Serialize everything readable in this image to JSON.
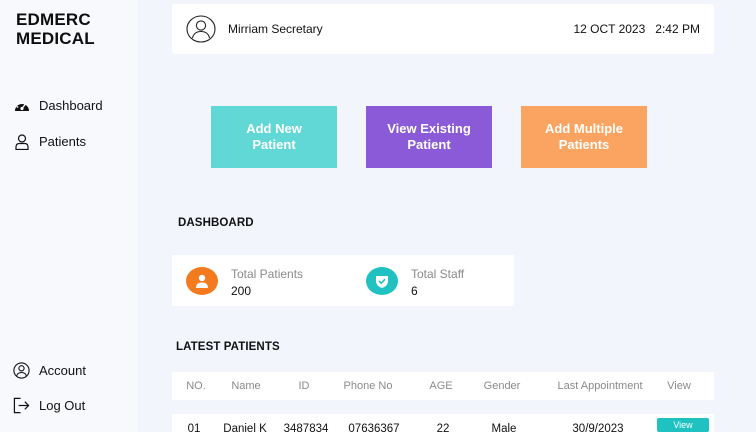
{
  "brand": {
    "line1": "EDMERC",
    "line2": "MEDICAL"
  },
  "sidebar": {
    "items": [
      {
        "label": "Dashboard",
        "icon": "dashboard-gauge-icon"
      },
      {
        "label": "Patients",
        "icon": "person-icon"
      }
    ],
    "bottom": [
      {
        "label": "Account",
        "icon": "account-circle-icon"
      },
      {
        "label": "Log Out",
        "icon": "logout-icon"
      }
    ]
  },
  "header": {
    "user_name": "Mirriam Secretary",
    "date": "12 OCT 2023",
    "time": "2:42 PM"
  },
  "actions": {
    "add_new": "Add New Patient",
    "view_existing": "View Existing Patient",
    "add_multiple": "Add Multiple Patients"
  },
  "dashboard": {
    "title": "DASHBOARD",
    "stats": [
      {
        "label": "Total Patients",
        "value": "200",
        "icon": "patient-icon",
        "color": "#f47a20"
      },
      {
        "label": "Total Staff",
        "value": "6",
        "icon": "shield-check-icon",
        "color": "#1fc2c0"
      }
    ]
  },
  "latest": {
    "title": "LATEST PATIENTS",
    "columns": [
      "NO.",
      "Name",
      "ID",
      "Phone No",
      "AGE",
      "Gender",
      "Last Appointment",
      "View"
    ],
    "rows": [
      {
        "no": "01",
        "name": "Daniel K",
        "id": "3487834",
        "phone": "07636367",
        "age": "22",
        "gender": "Male",
        "last_appointment": "30/9/2023",
        "action": "View"
      }
    ]
  },
  "colors": {
    "add_new": "#62d8d6",
    "view_existing": "#8b5ad9",
    "add_multiple": "#fba462",
    "background": "#f2f5fc"
  }
}
